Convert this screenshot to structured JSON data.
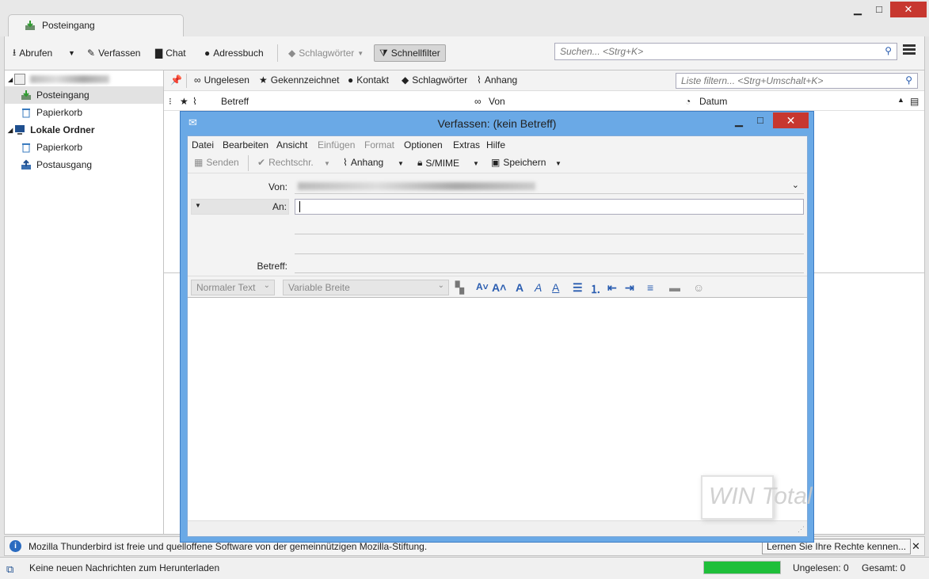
{
  "tab": {
    "label": "Posteingang",
    "icon": "inbox-download-icon"
  },
  "window_controls": {
    "minimize": "▁",
    "maximize": "□",
    "close": "✕"
  },
  "toolbar": {
    "get_mail": "Abrufen",
    "write": "Verfassen",
    "chat": "Chat",
    "address_book": "Adressbuch",
    "tags": "Schlagwörter",
    "quick_filter": "Schnellfilter",
    "search_placeholder": "Suchen... <Strg+K>"
  },
  "folders": {
    "lokale_ordner": "Lokale Ordner",
    "items": [
      {
        "label": "Posteingang",
        "icon": "inbox-icon"
      },
      {
        "label": "Papierkorb",
        "icon": "trash-icon"
      },
      {
        "label": "Papierkorb",
        "icon": "trash-icon"
      },
      {
        "label": "Postausgang",
        "icon": "outbox-icon"
      }
    ]
  },
  "quickfilter": {
    "unread": "Ungelesen",
    "flagged": "Gekennzeichnet",
    "contact": "Kontakt",
    "tags": "Schlagwörter",
    "attachment": "Anhang",
    "placeholder": "Liste filtern... <Strg+Umschalt+K>"
  },
  "columns": {
    "subject": "Betreff",
    "from": "Von",
    "date": "Datum"
  },
  "compose": {
    "title": "Verfassen: (kein Betreff)",
    "menu": [
      "Datei",
      "Bearbeiten",
      "Ansicht",
      "Einfügen",
      "Format",
      "Optionen",
      "Extras",
      "Hilfe"
    ],
    "toolbar": {
      "send": "Senden",
      "spell": "Rechtschr.",
      "attach": "Anhang",
      "smime": "S/MIME",
      "save": "Speichern"
    },
    "labels": {
      "from": "Von:",
      "to": "An:",
      "subject": "Betreff:"
    },
    "format": {
      "paragraph": "Normaler Text",
      "font": "Variable Breite"
    }
  },
  "infobar": {
    "message": "Mozilla Thunderbird ist freie und quelloffene Software von der gemeinnützigen Mozilla-Stiftung.",
    "button": "Lernen Sie Ihre Rechte kennen..."
  },
  "status": {
    "message": "Keine neuen Nachrichten zum Herunterladen",
    "unread": "Ungelesen: 0",
    "total": "Gesamt: 0"
  },
  "watermark": "WIN Total",
  "colors": {
    "accent": "#6aa9e6",
    "close": "#c7372f",
    "progress": "#1fbf3a"
  }
}
